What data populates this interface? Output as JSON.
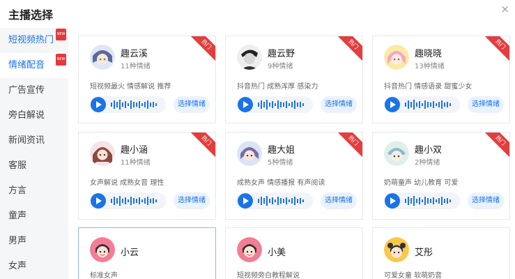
{
  "dialog": {
    "title": "主播选择",
    "close_label": "×"
  },
  "sidebar": {
    "items": [
      {
        "label": "短视频热门",
        "badge": "NEW"
      },
      {
        "label": "情绪配音",
        "badge": "NEW"
      },
      {
        "label": "广告宣传"
      },
      {
        "label": "旁白解说"
      },
      {
        "label": "新闻资讯"
      },
      {
        "label": "客服"
      },
      {
        "label": "方言"
      },
      {
        "label": "童声"
      },
      {
        "label": "男声"
      },
      {
        "label": "女声"
      }
    ]
  },
  "cards": [
    {
      "name": "趣云溪",
      "count": "11种情绪",
      "tags": "短视频最火 情感解说 推荐",
      "hot": "热门",
      "select": "选择情绪",
      "avatar": "anime-girl-blue-avatar"
    },
    {
      "name": "趣云野",
      "count": "9种情绪",
      "tags": "抖音热门 成熟浑厚 感染力",
      "hot": "热门",
      "select": "选择情绪",
      "avatar": "bw-man-avatar"
    },
    {
      "name": "趣晓晓",
      "count": "13种情绪",
      "tags": "抖音热门 情感语录 甜蜜少女",
      "hot": "热门",
      "select": "选择情绪",
      "avatar": "anime-girl-pink-avatar"
    },
    {
      "name": "趣小涵",
      "count": "11种情绪",
      "tags": "女声解说 成熟女音 理性",
      "hot": "热门",
      "select": "选择情绪",
      "avatar": "anime-woman-avatar"
    },
    {
      "name": "趣大姐",
      "count": "5种情绪",
      "tags": "成熟女声 情感播报 有声阅读",
      "hot": "热门",
      "select": "选择情绪",
      "avatar": "anime-lady-purple-avatar"
    },
    {
      "name": "趣小双",
      "count": "2种情绪",
      "tags": "奶萌童声 幼儿教育 可爱",
      "hot": "热门",
      "select": "选择情绪",
      "avatar": "anime-kid-avatar"
    },
    {
      "name": "小云",
      "tags": "标准女声",
      "avatar": "cartoon-girl-avatar"
    },
    {
      "name": "小美",
      "tags": "短视频旁白教程解说",
      "avatar": "cartoon-girl-avatar"
    },
    {
      "name": "艾彤",
      "tags": "可爱女童 软萌奶音",
      "avatar": "cartoon-child-avatar"
    }
  ],
  "colors": {
    "accent": "#1a73e8",
    "hot_ribbon": "#e43d3d",
    "sidebar_bg": "#f5f6f8"
  }
}
